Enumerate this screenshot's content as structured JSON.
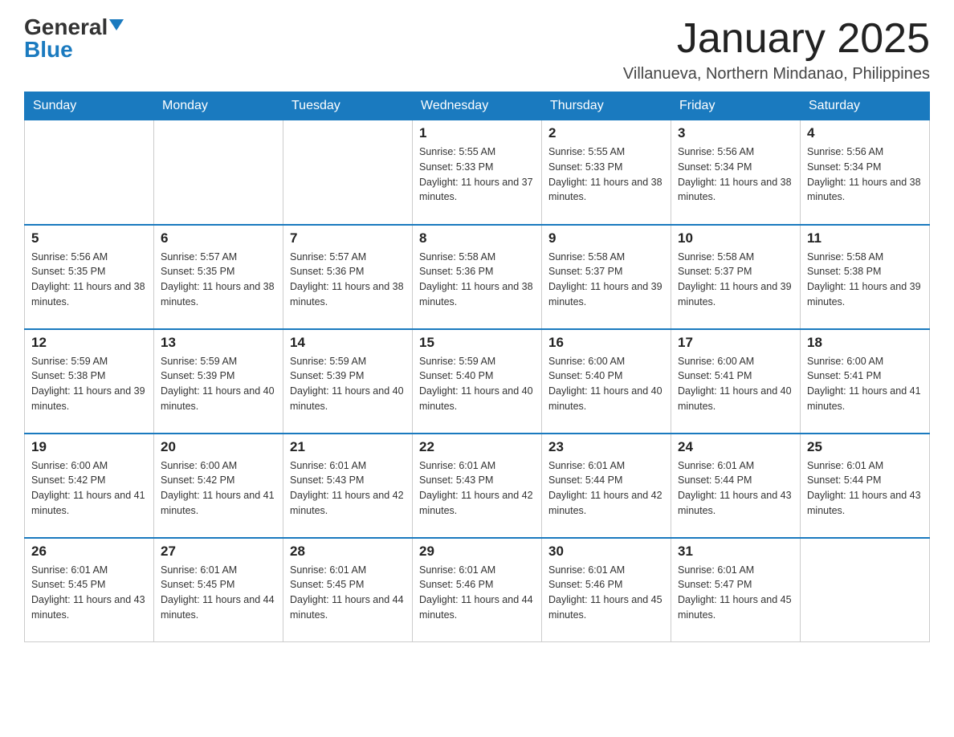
{
  "logo": {
    "general": "General",
    "blue": "Blue"
  },
  "title": "January 2025",
  "location": "Villanueva, Northern Mindanao, Philippines",
  "days_of_week": [
    "Sunday",
    "Monday",
    "Tuesday",
    "Wednesday",
    "Thursday",
    "Friday",
    "Saturday"
  ],
  "weeks": [
    [
      {
        "day": "",
        "info": ""
      },
      {
        "day": "",
        "info": ""
      },
      {
        "day": "",
        "info": ""
      },
      {
        "day": "1",
        "info": "Sunrise: 5:55 AM\nSunset: 5:33 PM\nDaylight: 11 hours and 37 minutes."
      },
      {
        "day": "2",
        "info": "Sunrise: 5:55 AM\nSunset: 5:33 PM\nDaylight: 11 hours and 38 minutes."
      },
      {
        "day": "3",
        "info": "Sunrise: 5:56 AM\nSunset: 5:34 PM\nDaylight: 11 hours and 38 minutes."
      },
      {
        "day": "4",
        "info": "Sunrise: 5:56 AM\nSunset: 5:34 PM\nDaylight: 11 hours and 38 minutes."
      }
    ],
    [
      {
        "day": "5",
        "info": "Sunrise: 5:56 AM\nSunset: 5:35 PM\nDaylight: 11 hours and 38 minutes."
      },
      {
        "day": "6",
        "info": "Sunrise: 5:57 AM\nSunset: 5:35 PM\nDaylight: 11 hours and 38 minutes."
      },
      {
        "day": "7",
        "info": "Sunrise: 5:57 AM\nSunset: 5:36 PM\nDaylight: 11 hours and 38 minutes."
      },
      {
        "day": "8",
        "info": "Sunrise: 5:58 AM\nSunset: 5:36 PM\nDaylight: 11 hours and 38 minutes."
      },
      {
        "day": "9",
        "info": "Sunrise: 5:58 AM\nSunset: 5:37 PM\nDaylight: 11 hours and 39 minutes."
      },
      {
        "day": "10",
        "info": "Sunrise: 5:58 AM\nSunset: 5:37 PM\nDaylight: 11 hours and 39 minutes."
      },
      {
        "day": "11",
        "info": "Sunrise: 5:58 AM\nSunset: 5:38 PM\nDaylight: 11 hours and 39 minutes."
      }
    ],
    [
      {
        "day": "12",
        "info": "Sunrise: 5:59 AM\nSunset: 5:38 PM\nDaylight: 11 hours and 39 minutes."
      },
      {
        "day": "13",
        "info": "Sunrise: 5:59 AM\nSunset: 5:39 PM\nDaylight: 11 hours and 40 minutes."
      },
      {
        "day": "14",
        "info": "Sunrise: 5:59 AM\nSunset: 5:39 PM\nDaylight: 11 hours and 40 minutes."
      },
      {
        "day": "15",
        "info": "Sunrise: 5:59 AM\nSunset: 5:40 PM\nDaylight: 11 hours and 40 minutes."
      },
      {
        "day": "16",
        "info": "Sunrise: 6:00 AM\nSunset: 5:40 PM\nDaylight: 11 hours and 40 minutes."
      },
      {
        "day": "17",
        "info": "Sunrise: 6:00 AM\nSunset: 5:41 PM\nDaylight: 11 hours and 40 minutes."
      },
      {
        "day": "18",
        "info": "Sunrise: 6:00 AM\nSunset: 5:41 PM\nDaylight: 11 hours and 41 minutes."
      }
    ],
    [
      {
        "day": "19",
        "info": "Sunrise: 6:00 AM\nSunset: 5:42 PM\nDaylight: 11 hours and 41 minutes."
      },
      {
        "day": "20",
        "info": "Sunrise: 6:00 AM\nSunset: 5:42 PM\nDaylight: 11 hours and 41 minutes."
      },
      {
        "day": "21",
        "info": "Sunrise: 6:01 AM\nSunset: 5:43 PM\nDaylight: 11 hours and 42 minutes."
      },
      {
        "day": "22",
        "info": "Sunrise: 6:01 AM\nSunset: 5:43 PM\nDaylight: 11 hours and 42 minutes."
      },
      {
        "day": "23",
        "info": "Sunrise: 6:01 AM\nSunset: 5:44 PM\nDaylight: 11 hours and 42 minutes."
      },
      {
        "day": "24",
        "info": "Sunrise: 6:01 AM\nSunset: 5:44 PM\nDaylight: 11 hours and 43 minutes."
      },
      {
        "day": "25",
        "info": "Sunrise: 6:01 AM\nSunset: 5:44 PM\nDaylight: 11 hours and 43 minutes."
      }
    ],
    [
      {
        "day": "26",
        "info": "Sunrise: 6:01 AM\nSunset: 5:45 PM\nDaylight: 11 hours and 43 minutes."
      },
      {
        "day": "27",
        "info": "Sunrise: 6:01 AM\nSunset: 5:45 PM\nDaylight: 11 hours and 44 minutes."
      },
      {
        "day": "28",
        "info": "Sunrise: 6:01 AM\nSunset: 5:45 PM\nDaylight: 11 hours and 44 minutes."
      },
      {
        "day": "29",
        "info": "Sunrise: 6:01 AM\nSunset: 5:46 PM\nDaylight: 11 hours and 44 minutes."
      },
      {
        "day": "30",
        "info": "Sunrise: 6:01 AM\nSunset: 5:46 PM\nDaylight: 11 hours and 45 minutes."
      },
      {
        "day": "31",
        "info": "Sunrise: 6:01 AM\nSunset: 5:47 PM\nDaylight: 11 hours and 45 minutes."
      },
      {
        "day": "",
        "info": ""
      }
    ]
  ]
}
